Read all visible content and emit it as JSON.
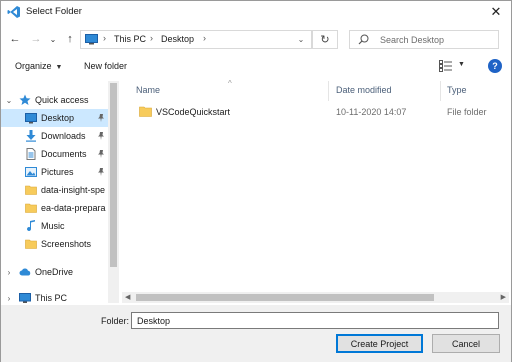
{
  "window": {
    "title": "Select Folder",
    "close_glyph": "✕"
  },
  "nav": {
    "back_glyph": "←",
    "forward_glyph": "→",
    "recent_glyph": "⌄",
    "up_glyph": "↑",
    "address_segments": [
      "This PC",
      "Desktop"
    ],
    "address_sep": "›",
    "address_dropdown_glyph": "⌄",
    "refresh_glyph": "↻",
    "search_placeholder": "Search Desktop"
  },
  "toolbar": {
    "organize_label": "Organize",
    "organize_caret": "▼",
    "new_folder_label": "New folder",
    "view_caret": "▼",
    "help_glyph": "?"
  },
  "sidebar": {
    "items": [
      {
        "label": "Quick access",
        "icon": "star-icon",
        "expander": "⌄"
      },
      {
        "label": "Desktop",
        "icon": "desktop-icon",
        "pinned": true,
        "selected": true
      },
      {
        "label": "Downloads",
        "icon": "download-icon",
        "pinned": true
      },
      {
        "label": "Documents",
        "icon": "document-icon",
        "pinned": true
      },
      {
        "label": "Pictures",
        "icon": "pictures-icon",
        "pinned": true
      },
      {
        "label": "data-insight-spe",
        "icon": "folder-icon"
      },
      {
        "label": "ea-data-prepara",
        "icon": "folder-icon"
      },
      {
        "label": "Music",
        "icon": "music-icon"
      },
      {
        "label": "Screenshots",
        "icon": "folder-icon"
      },
      {
        "label": "OneDrive",
        "icon": "cloud-icon",
        "expander": "›"
      },
      {
        "label": "This PC",
        "icon": "pc-icon",
        "expander": "›"
      }
    ]
  },
  "columns": {
    "name": "Name",
    "date_modified": "Date modified",
    "type": "Type",
    "sort_glyph": "^"
  },
  "files": [
    {
      "name": "VSCodeQuickstart",
      "date_modified": "10-11-2020 14:07",
      "type": "File folder"
    }
  ],
  "footer": {
    "folder_label": "Folder:",
    "folder_value": "Desktop",
    "create_button": "Create Project",
    "cancel_button": "Cancel"
  },
  "colors": {
    "accent": "#0078d7",
    "selection": "#cce8ff",
    "folder": "#f7cb5b",
    "vscode": "#2f8ad6"
  }
}
